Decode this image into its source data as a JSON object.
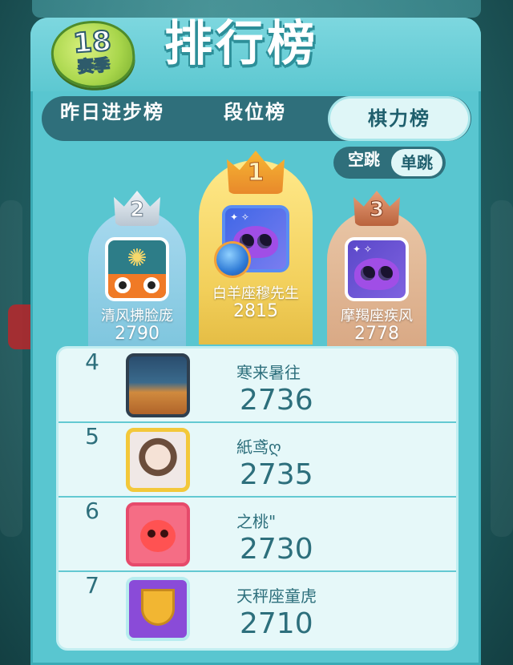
{
  "header": {
    "season_number": "18",
    "season_label": "赛季",
    "title": "排行榜"
  },
  "tabs": [
    {
      "label": "昨日进步榜",
      "active": false
    },
    {
      "label": "段位榜",
      "active": false
    },
    {
      "label": "棋力榜",
      "active": true
    }
  ],
  "jump_toggle": {
    "options": [
      "空跳",
      "单跳"
    ],
    "selected": "单跳"
  },
  "podium": [
    {
      "rank": "1",
      "name": "白羊座穆先生",
      "score": "2815",
      "crown": "gold"
    },
    {
      "rank": "2",
      "name": "清风拂脸庞",
      "score": "2790",
      "crown": "silver"
    },
    {
      "rank": "3",
      "name": "摩羯座疾风",
      "score": "2778",
      "crown": "bronze"
    }
  ],
  "list": [
    {
      "rank": "4",
      "name": "寒来暑往",
      "score": "2736"
    },
    {
      "rank": "5",
      "name": "紙鸢ღ",
      "score": "2735"
    },
    {
      "rank": "6",
      "name": "之桃\"",
      "score": "2730"
    },
    {
      "rank": "7",
      "name": "天秤座童虎",
      "score": "2710"
    }
  ],
  "colors": {
    "panel": "#59c6d0",
    "tab_bar": "#2f6f7b",
    "text_dark": "#2d6f7c",
    "gold": "#f2cf5a",
    "silver": "#a8d9ef",
    "bronze": "#d9a985"
  }
}
